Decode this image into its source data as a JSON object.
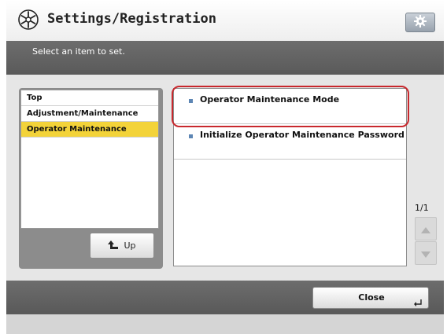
{
  "header": {
    "title": "Settings/Registration",
    "title_icon": "settings-star-icon",
    "gear_icon": "gear-icon"
  },
  "message": {
    "text": "Select an item to set."
  },
  "tree": {
    "items": [
      {
        "label": "Top",
        "selected": false
      },
      {
        "label": "Adjustment/Maintenance",
        "selected": false
      },
      {
        "label": "Operator Maintenance",
        "selected": true
      }
    ],
    "up_label": "Up",
    "up_icon": "up-arrow-icon"
  },
  "list": {
    "items": [
      {
        "label": "Operator Maintenance Mode",
        "highlighted": true
      },
      {
        "label": "Initialize Operator Maintenance Password",
        "highlighted": false
      }
    ]
  },
  "pager": {
    "indicator": "1/1"
  },
  "footer": {
    "close_label": "Close"
  },
  "colors": {
    "selected_bg": "#f3d339",
    "highlight_border": "#c8282d",
    "bullet": "#5d86b4"
  }
}
